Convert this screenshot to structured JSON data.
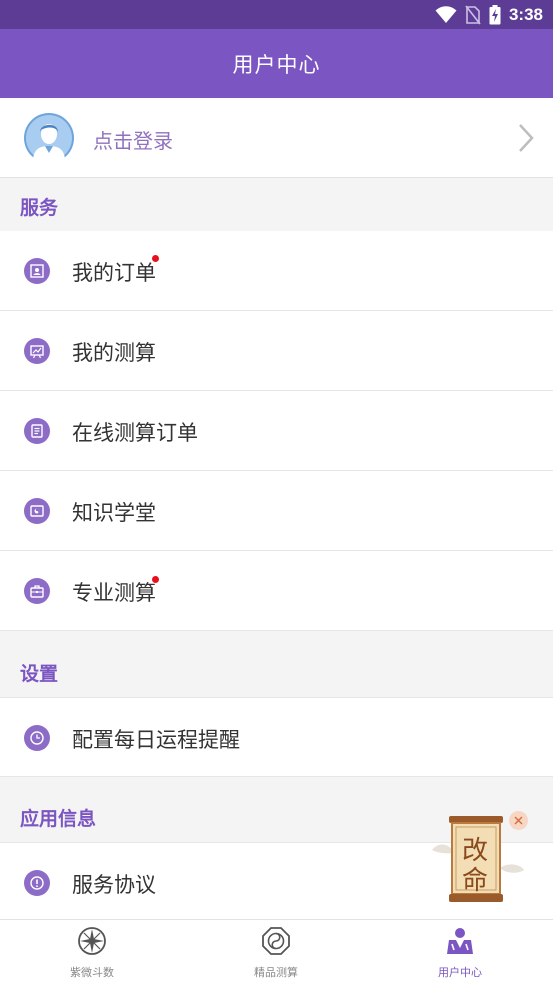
{
  "status_bar": {
    "time": "3:38",
    "icons": [
      "wifi-icon",
      "no-sim-icon",
      "battery-charging-icon"
    ]
  },
  "app_bar": {
    "title": "用户中心"
  },
  "login": {
    "label": "点击登录",
    "avatar_icon": "default-avatar-icon",
    "chevron_icon": "chevron-right-icon"
  },
  "sections": {
    "services": {
      "title": "服务"
    },
    "settings": {
      "title": "设置"
    },
    "app_info": {
      "title": "应用信息"
    }
  },
  "menu": {
    "my_orders": {
      "label": "我的订单",
      "icon": "portrait-frame-icon",
      "has_badge": true
    },
    "my_readings": {
      "label": "我的测算",
      "icon": "chart-board-icon",
      "has_badge": false
    },
    "online_reading_orders": {
      "label": "在线测算订单",
      "icon": "document-list-icon",
      "has_badge": false
    },
    "knowledge_school": {
      "label": "知识学堂",
      "icon": "book-icon",
      "has_badge": false
    },
    "pro_reading": {
      "label": "专业测算",
      "icon": "briefcase-icon",
      "has_badge": true
    },
    "daily_reminder": {
      "label": "配置每日运程提醒",
      "icon": "clock-icon",
      "has_badge": false
    },
    "service_agreement": {
      "label": "服务协议",
      "icon": "info-icon",
      "has_badge": false
    }
  },
  "promo": {
    "text_top": "改",
    "text_bottom": "命",
    "close_icon": "close-icon"
  },
  "tab_bar": {
    "tabs": [
      {
        "label": "紫微斗数",
        "icon": "compass-star-icon",
        "active": false
      },
      {
        "label": "精品测算",
        "icon": "taiji-octagon-icon",
        "active": false
      },
      {
        "label": "用户中心",
        "icon": "user-center-icon",
        "active": true
      }
    ]
  },
  "colors": {
    "primary": "#7b55c1",
    "status_bar": "#5d3c96",
    "badge": "#e8101a",
    "icon_bg": "#8c6cc7"
  }
}
